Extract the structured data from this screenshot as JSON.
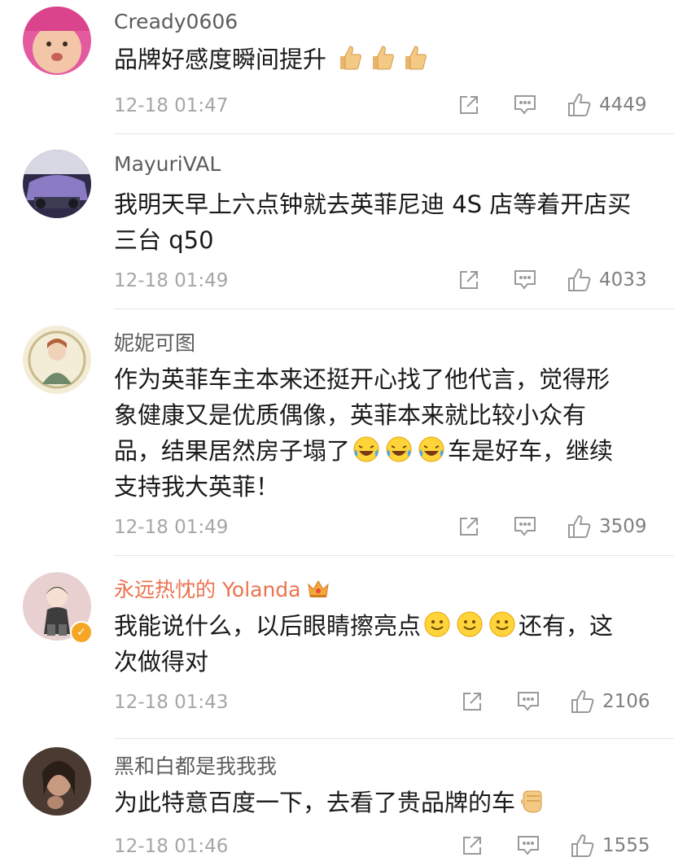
{
  "colors": {
    "name": "#5c5c5c",
    "vip_name": "#eb7350",
    "text": "#1a1a1a",
    "meta": "#a6a6a6",
    "divider": "#e6e6e6"
  },
  "comments": [
    {
      "username": "Cready0606",
      "text": "品牌好感度瞬间提升",
      "emoji": [
        "thumbs-up",
        "thumbs-up",
        "thumbs-up"
      ],
      "time": "12-18 01:47",
      "likes": "4449"
    },
    {
      "username": "MayuriVAL",
      "text_line1": "我明天早上六点钟就去英菲尼迪 4S 店等着开店买",
      "text_line2": "三台 q50",
      "time": "12-18 01:49",
      "likes": "4033"
    },
    {
      "username": "妮妮可图",
      "text_line1": "作为英菲车主本来还挺开心找了他代言，觉得形",
      "text_line2": "象健康又是优质偶像，英菲本来就比较小众有",
      "text_line3a": "品，结果居然房子塌了",
      "text_line3b": "车是好车，继续",
      "text_line4": "支持我大英菲！",
      "emoji": [
        "laugh-cry",
        "laugh-cry",
        "laugh-cry"
      ],
      "time": "12-18 01:49",
      "likes": "3509"
    },
    {
      "username": "永远热忱的 Yolanda",
      "verified": true,
      "text_line1a": "我能说什么，以后眼睛擦亮点",
      "text_line1b": "还有，这",
      "text_line2": "次做得对",
      "emoji": [
        "smile",
        "smile",
        "smile"
      ],
      "time": "12-18 01:43",
      "likes": "2106"
    },
    {
      "username": "黑和白都是我我我",
      "text": "为此特意百度一下，去看了贵品牌的车",
      "emoji": [
        "fist"
      ],
      "time": "12-18 01:46",
      "likes": "1555"
    }
  ]
}
